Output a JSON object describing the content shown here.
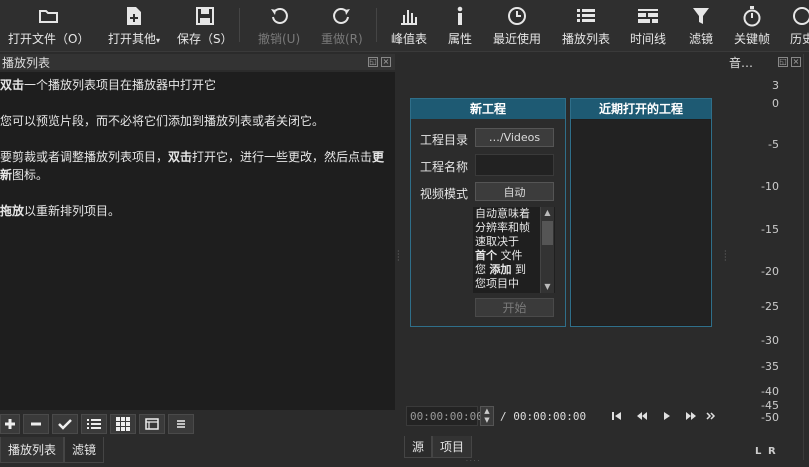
{
  "toolbar": {
    "items": [
      {
        "label": "打开文件（O）",
        "icon": "folder-open-icon"
      },
      {
        "label": "打开其他",
        "icon": "add-file-icon"
      },
      {
        "label": "保存（S）",
        "icon": "save-icon"
      },
      {
        "label": "撤销(U)",
        "icon": "undo-icon"
      },
      {
        "label": "重做(R)",
        "icon": "redo-icon"
      },
      {
        "label": "峰值表",
        "icon": "peak-meter-icon"
      },
      {
        "label": "属性",
        "icon": "info-icon"
      },
      {
        "label": "最近使用",
        "icon": "clock-icon"
      },
      {
        "label": "播放列表",
        "icon": "list-icon"
      },
      {
        "label": "时间线",
        "icon": "timeline-icon"
      },
      {
        "label": "滤镜",
        "icon": "filter-icon"
      },
      {
        "label": "关键帧",
        "icon": "stopwatch-icon"
      },
      {
        "label": "历史",
        "icon": "history-icon"
      }
    ]
  },
  "playlist": {
    "title": "播放列表",
    "help_1_bold": "双击",
    "help_1_rest": "一个播放列表项目在播放器中打开它",
    "help_2": "您可以预览片段，而不必将它们添加到播放列表或者关闭它。",
    "help_3_a": "要剪裁或者调整播放列表项目，",
    "help_3_bold": "双击",
    "help_3_b": "打开它，进行一些更改，然后点击",
    "help_3_bold2": "更新",
    "help_3_c": "图标。",
    "help_4_bold": "拖放",
    "help_4_rest": "以重新排列项目。",
    "tabs": [
      "播放列表",
      "滤镜"
    ]
  },
  "new_project": {
    "title": "新工程",
    "dir_label": "工程目录",
    "dir_value": "…/Videos",
    "name_label": "工程名称",
    "name_value": "",
    "mode_label": "视频模式",
    "mode_value": "自动",
    "description_lines": [
      {
        "text": "自动意味着",
        "bold": false
      },
      {
        "text": "分辨率和帧",
        "bold": false
      },
      {
        "text": "速取决于",
        "bold": false
      }
    ],
    "desc_line4_bold": "首个",
    "desc_line4_rest": " 文件",
    "desc_line5_a": "您 ",
    "desc_line5_bold": "添加",
    "desc_line5_b": " 到",
    "desc_line6": "您项目中",
    "start_label": "开始"
  },
  "recent_projects": {
    "title": "近期打开的工程"
  },
  "transport": {
    "position": "00:00:00:00",
    "separator": "/",
    "duration": "00:00:00:00"
  },
  "center_tabs": [
    "源",
    "项目"
  ],
  "audio_meter": {
    "title": "音…",
    "ticks": [
      "3",
      "0",
      "-5",
      "-10",
      "-15",
      "-20",
      "-25",
      "-30",
      "-35",
      "-40",
      "-45",
      "-50"
    ],
    "left_label": "L",
    "right_label": "R"
  }
}
